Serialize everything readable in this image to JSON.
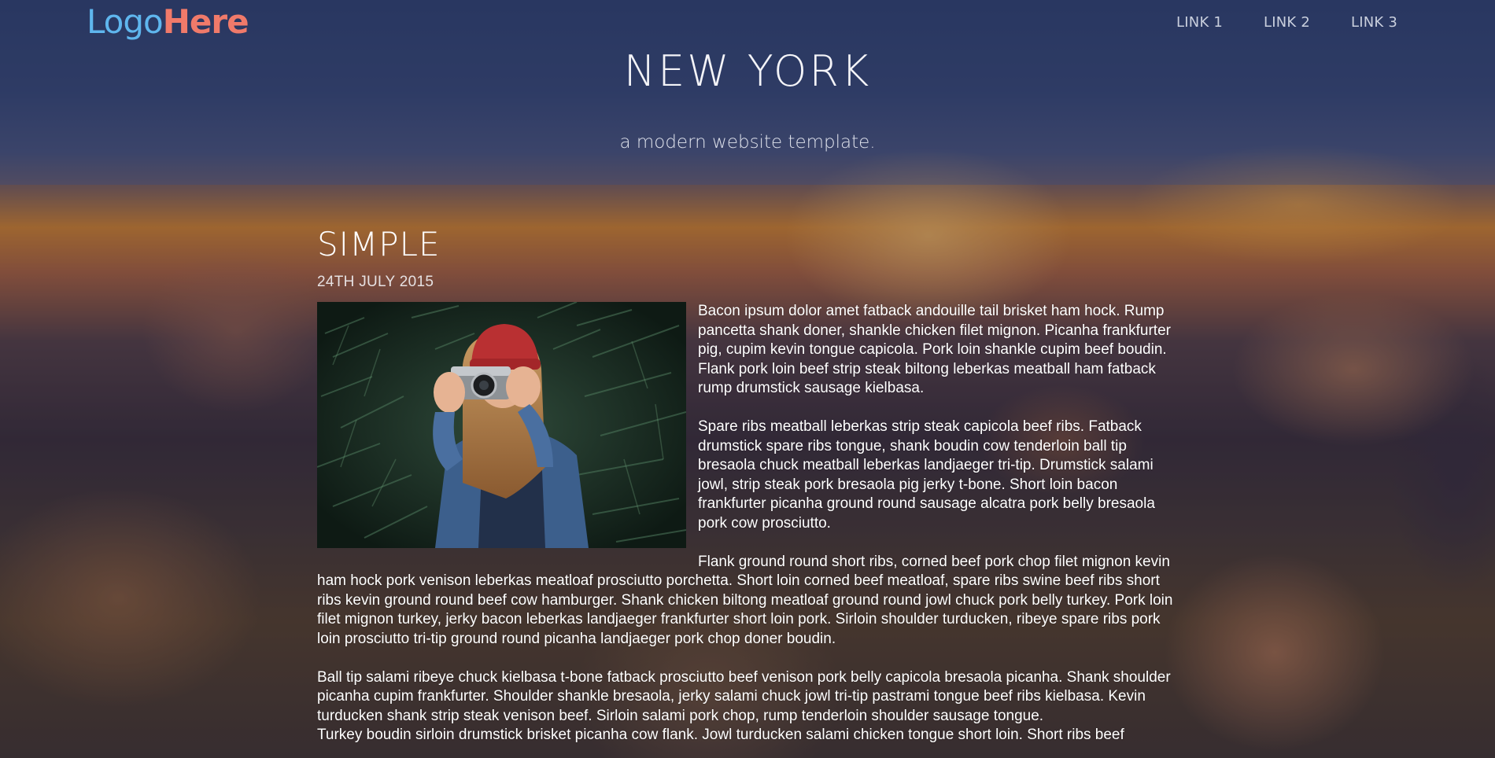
{
  "logo": {
    "part1": "Logo",
    "part2": "Here"
  },
  "nav": {
    "links": [
      "LINK 1",
      "LINK 2",
      "LINK 3"
    ]
  },
  "hero": {
    "title": "NEW YORK",
    "subtitle": "a modern website template."
  },
  "post": {
    "title": "SIMPLE",
    "date": "24TH JULY 2015",
    "paragraphs": [
      "Bacon ipsum dolor amet fatback andouille tail brisket ham hock. Rump pancetta shank doner, shankle chicken filet mignon. Picanha frankfurter pig, cupim kevin tongue capicola. Pork loin shankle cupim beef boudin. Flank pork loin beef strip steak biltong leberkas meatball ham fatback rump drumstick sausage kielbasa.",
      "Spare ribs meatball leberkas strip steak capicola beef ribs. Fatback drumstick spare ribs tongue, shank boudin cow tenderloin ball tip bresaola chuck meatball leberkas landjaeger tri-tip. Drumstick salami jowl, strip steak pork bresaola pig jerky t-bone. Short loin bacon frankfurter picanha ground round sausage alcatra pork belly bresaola pork cow prosciutto.",
      "Flank ground round short ribs, corned beef pork chop filet mignon kevin ham hock pork venison leberkas meatloaf prosciutto porchetta. Short loin corned beef meatloaf, spare ribs swine beef ribs short ribs kevin ground round beef cow hamburger. Shank chicken biltong meatloaf ground round jowl chuck pork belly turkey. Pork loin filet mignon turkey, jerky bacon leberkas landjaeger frankfurter short loin pork. Sirloin shoulder turducken, ribeye spare ribs pork loin prosciutto tri-tip ground round picanha landjaeger pork chop doner boudin.",
      "Ball tip salami ribeye chuck kielbasa t-bone fatback prosciutto beef venison pork belly capicola bresaola picanha. Shank shoulder picanha cupim frankfurter. Shoulder shankle bresaola, jerky salami chuck jowl tri-tip pastrami tongue beef ribs kielbasa. Kevin turducken shank strip steak venison beef. Sirloin salami pork chop, rump tenderloin shoulder sausage tongue.",
      "Turkey boudin sirloin drumstick brisket picanha cow flank. Jowl turducken salami chicken tongue short loin. Short ribs beef"
    ]
  }
}
